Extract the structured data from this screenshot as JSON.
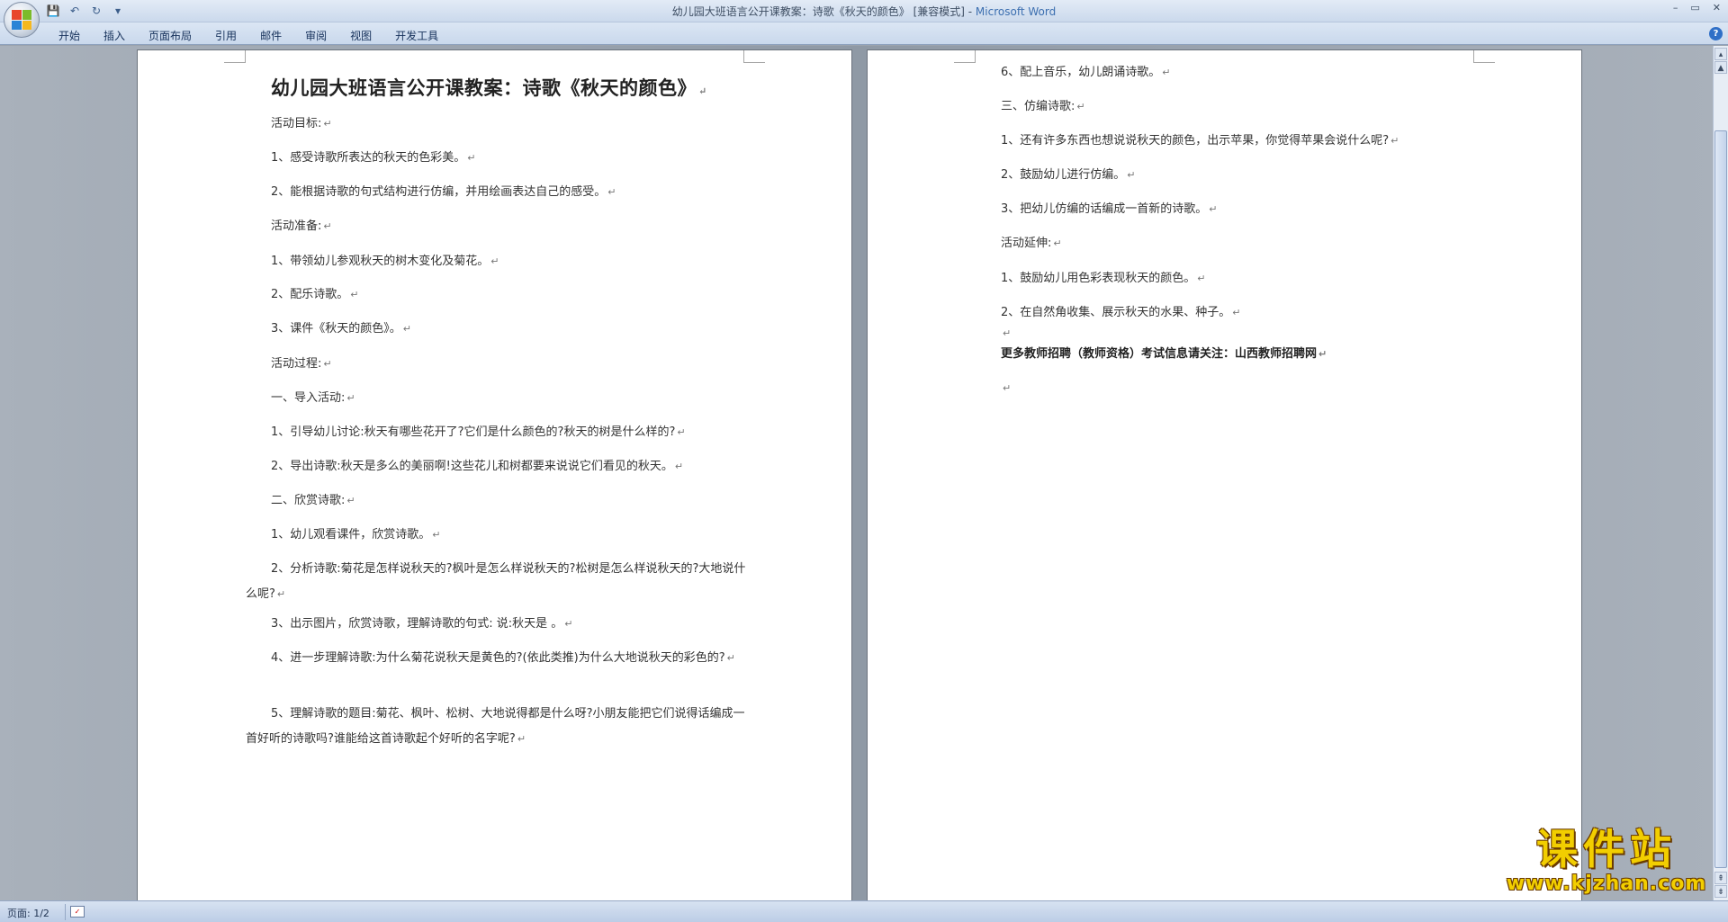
{
  "window": {
    "title": "幼儿园大班语言公开课教案：诗歌《秋天的颜色》 [兼容模式] - ",
    "app_name": "Microsoft Word",
    "minimize": "–",
    "restore": "▭",
    "close": "✕"
  },
  "qat": {
    "save": "💾",
    "undo": "↶",
    "redo": "↻",
    "more": "▾"
  },
  "ribbon": {
    "tabs": [
      "开始",
      "插入",
      "页面布局",
      "引用",
      "邮件",
      "审阅",
      "视图",
      "开发工具"
    ],
    "help": "?"
  },
  "page1": {
    "title": "幼儿园大班语言公开课教案：诗歌《秋天的颜色》",
    "paragraphs": [
      "活动目标:",
      "1、感受诗歌所表达的秋天的色彩美。",
      "2、能根据诗歌的句式结构进行仿编，并用绘画表达自己的感受。",
      "活动准备:",
      "1、带领幼儿参观秋天的树木变化及菊花。",
      "2、配乐诗歌。",
      "3、课件《秋天的颜色》。",
      "活动过程:",
      "一、导入活动:",
      "1、引导幼儿讨论:秋天有哪些花开了?它们是什么颜色的?秋天的树是什么样的?",
      "2、导出诗歌:秋天是多么的美丽啊!这些花儿和树都要来说说它们看见的秋天。",
      "二、欣赏诗歌:",
      "1、幼儿观看课件，欣赏诗歌。",
      "2、分析诗歌:菊花是怎样说秋天的?枫叶是怎么样说秋天的?松树是怎么样说秋天的?大地说什么呢?",
      "3、出示图片，欣赏诗歌，理解诗歌的句式: 说:秋天是 。",
      "4、进一步理解诗歌:为什么菊花说秋天是黄色的?(依此类推)为什么大地说秋天的彩色的?",
      "5、理解诗歌的题目:菊花、枫叶、松树、大地说得都是什么呀?小朋友能把它们说得话编成一首好听的诗歌吗?谁能给这首诗歌起个好听的名字呢?"
    ]
  },
  "page2": {
    "paragraphs": [
      "6、配上音乐，幼儿朗诵诗歌。",
      "三、仿编诗歌:",
      "1、还有许多东西也想说说秋天的颜色，出示苹果，你觉得苹果会说什么呢?",
      "2、鼓励幼儿进行仿编。",
      "3、把幼儿仿编的话编成一首新的诗歌。",
      "活动延伸:",
      "1、鼓励幼儿用色彩表现秋天的颜色。",
      "2、在自然角收集、展示秋天的水果、种子。",
      "",
      "更多教师招聘（教师资格）考试信息请关注：山西教师招聘网",
      ""
    ]
  },
  "para_mark": "↵",
  "statusbar": {
    "page_count": "页面: 1/2"
  },
  "watermark": {
    "text": "课件站",
    "url": "www.kjzhan.com"
  },
  "colors": {
    "ribbon": "#c9d8ec",
    "app_name": "#3c6fb0",
    "watermark": "#f2ce00"
  }
}
